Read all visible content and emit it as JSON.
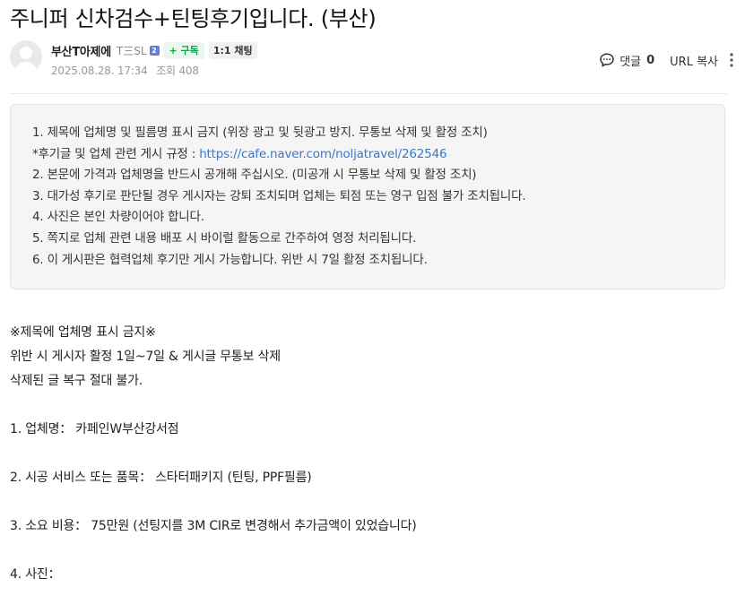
{
  "post": {
    "title": "주니퍼 신차검수+틴팅후기입니다. (부산)"
  },
  "author": {
    "name": "부산T아제에",
    "level": "T三SL",
    "level_badge": "2",
    "subscribe_label": "+ 구독",
    "chat_label": "1:1 채팅",
    "date": "2025.08.28. 17:34",
    "views": "조회 408"
  },
  "actions": {
    "comment_label": "댓글",
    "comment_count": "0",
    "url_copy_label": "URL 복사"
  },
  "notice": {
    "line1": "1. 제목에 업체명 및 필름명 표시 금지 (위장 광고 및 뒷광고 방지. 무통보 삭제 및 활정 조치)",
    "line2_prefix": "*후기글 및 업체 관련 게시 규정 : ",
    "line2_link": "https://cafe.naver.com/noljatravel/262546",
    "line3": "2. 본문에 가격과 업체명을 반드시 공개해 주십시오. (미공개 시 무통보 삭제 및 활정 조치)",
    "line4": "3. 대가성 후기로 판단될 경우 게시자는 강퇴 조치되며 업체는 퇴점 또는 영구 입점 불가 조치됩니다.",
    "line5": "4. 사진은 본인 차량이어야 합니다.",
    "line6": "5. 쪽지로 업체 관련 내용 배포 시 바이럴 활동으로 간주하여 영정 처리됩니다.",
    "line7": "6. 이 게시판은 협력업체 후기만 게시 가능합니다. 위반 시 7일 활정 조치됩니다."
  },
  "body": {
    "line1": "※제목에 업체명 표시 금지※",
    "line2": "위반 시 게시자 활정 1일~7일 & 게시글 무통보 삭제",
    "line3": "삭제된 글 복구 절대 불가.",
    "line4": "1. 업체명： 카페인W부산강서점",
    "line5": "2. 시공 서비스 또는 품목： 스타터패키지 (틴팅, PPF필름)",
    "line6": "3. 소요 비용： 75만원 (선팅지를 3M CIR로 변경해서 추가금액이 있었습니다)",
    "line7": "4. 사진："
  }
}
